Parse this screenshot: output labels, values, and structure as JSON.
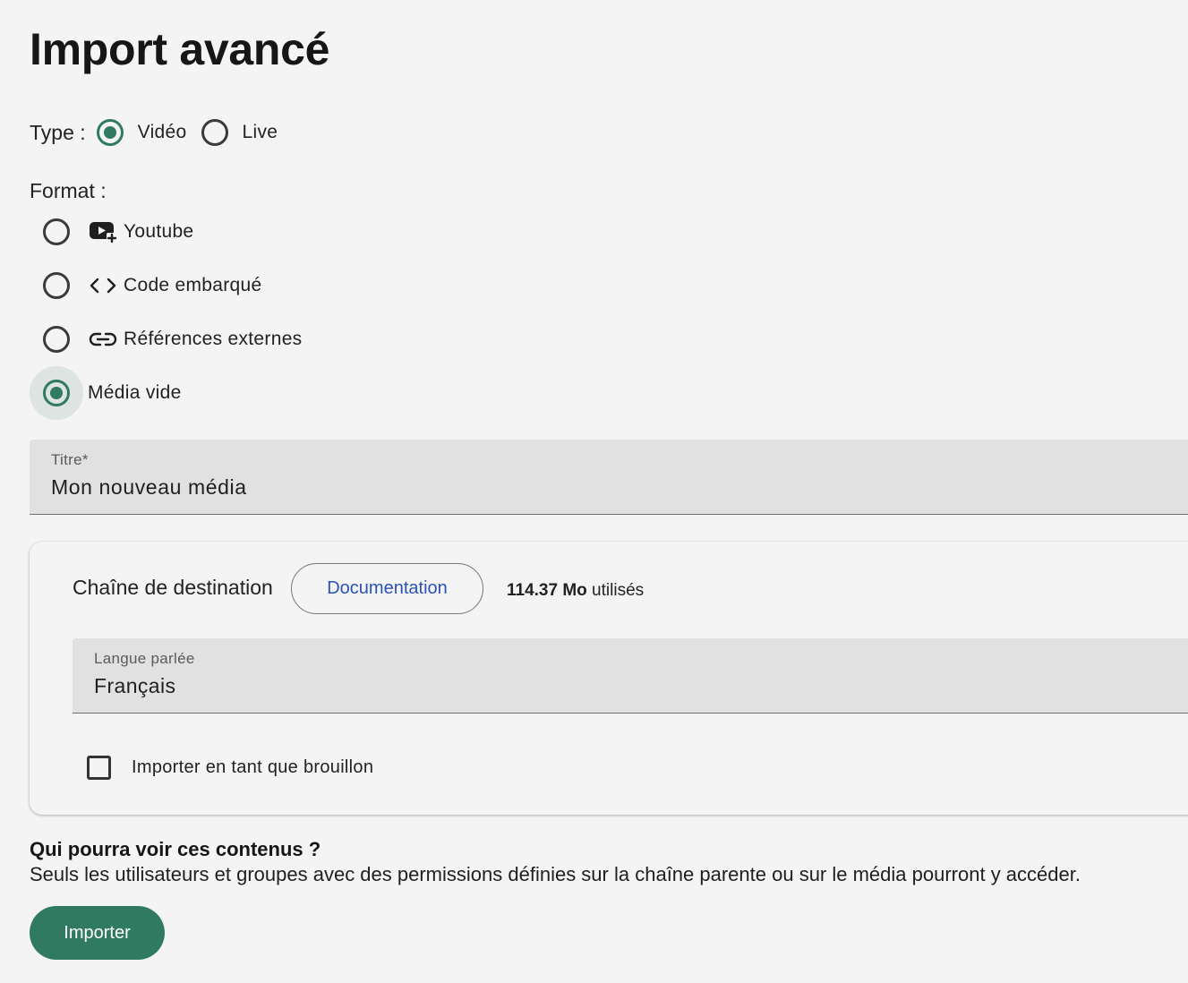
{
  "page": {
    "title": "Import avancé"
  },
  "type": {
    "label": "Type :",
    "options": [
      {
        "label": "Vidéo",
        "checked": true
      },
      {
        "label": "Live",
        "checked": false
      }
    ]
  },
  "format": {
    "label": "Format :",
    "options": [
      {
        "label": "Youtube",
        "icon": "youtube-add-icon",
        "checked": false
      },
      {
        "label": "Code embarqué",
        "icon": "code-icon",
        "checked": false
      },
      {
        "label": "Références externes",
        "icon": "link-icon",
        "checked": false
      },
      {
        "label": "Média vide",
        "icon": "",
        "checked": true
      }
    ]
  },
  "title_field": {
    "label": "Titre*",
    "value": "Mon nouveau média"
  },
  "destination": {
    "label": "Chaîne de destination",
    "doc_button": "Documentation",
    "usage_amount": "114.37 Mo",
    "usage_suffix": " utilisés",
    "language_field": {
      "label": "Langue parlée",
      "value": "Français"
    },
    "draft_checkbox": {
      "label": "Importer en tant que brouillon",
      "checked": false
    }
  },
  "visibility": {
    "title": "Qui pourra voir ces contenus ?",
    "text": "Seuls les utilisateurs et groupes avec des permissions définies sur la chaîne parente ou sur le média pourront y accéder."
  },
  "actions": {
    "import_label": "Importer"
  },
  "colors": {
    "accent": "#2f7a60",
    "link": "#2a52b8",
    "field_bg": "#e1e1e1",
    "page_bg": "#f4f4f4"
  }
}
